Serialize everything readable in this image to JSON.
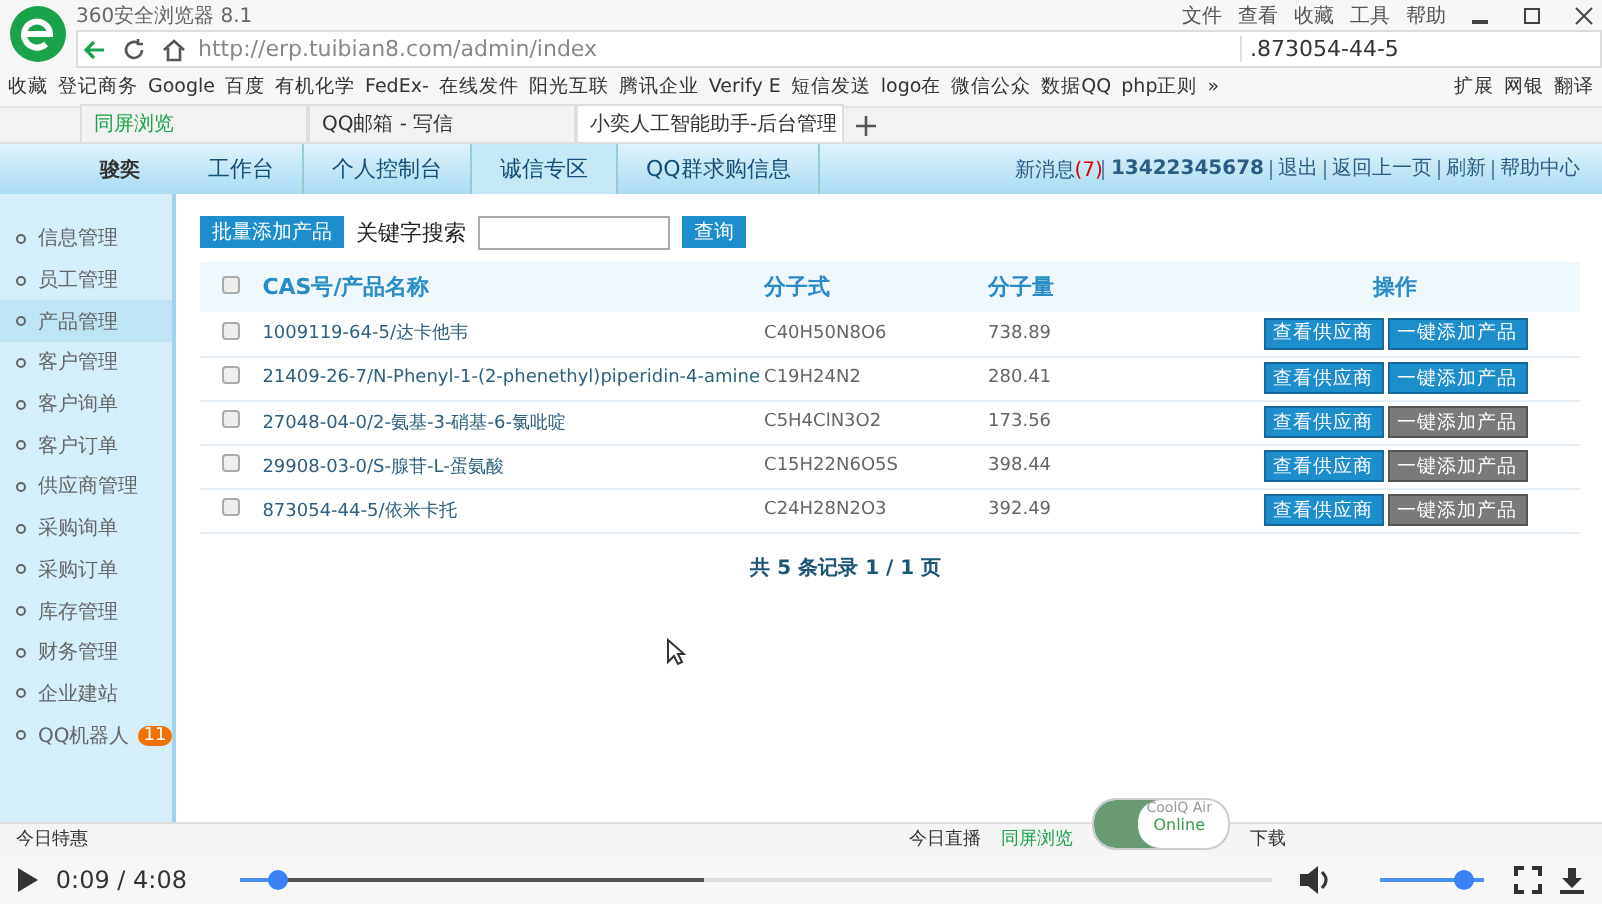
{
  "browser": {
    "title": "360安全浏览器 8.1",
    "menu": [
      "文件",
      "查看",
      "收藏",
      "工具",
      "帮助"
    ],
    "address": "http://erp.tuibian8.com/admin/index",
    "search": ".873054-44-5",
    "bookmarks": [
      "收藏",
      "登记商务",
      "Google",
      "百度",
      "有机化学",
      "FedEx-",
      "在线发件",
      "阳光互联",
      "腾讯企业",
      "Verify E",
      "短信发送",
      "logo在",
      "微信公众",
      "数据QQ",
      "php正则",
      "»"
    ],
    "extras": [
      "扩展",
      "网银",
      "翻译"
    ],
    "tabs": [
      {
        "label": "同屏浏览",
        "selected": false,
        "kind": "special"
      },
      {
        "label": "QQ邮箱 - 写信",
        "selected": false,
        "kind": "page"
      },
      {
        "label": "小奕人工智能助手-后台管理",
        "selected": true,
        "kind": "page"
      }
    ]
  },
  "header": {
    "logo": "骏奕",
    "nav": [
      {
        "label": "工作台",
        "selected": false
      },
      {
        "label": "个人控制台",
        "selected": false
      },
      {
        "label": "诚信专区",
        "selected": true
      },
      {
        "label": "QQ群求购信息",
        "selected": false
      }
    ],
    "messages_label": "新消息",
    "messages_count": "(7)",
    "links": [
      "13422345678",
      "退出",
      "返回上一页",
      "刷新",
      "帮助中心"
    ]
  },
  "sidebar": [
    {
      "label": "信息管理",
      "selected": false
    },
    {
      "label": "员工管理",
      "selected": false
    },
    {
      "label": "产品管理",
      "selected": true
    },
    {
      "label": "客户管理",
      "selected": false
    },
    {
      "label": "客户询单",
      "selected": false
    },
    {
      "label": "客户订单",
      "selected": false
    },
    {
      "label": "供应商管理",
      "selected": false
    },
    {
      "label": "采购询单",
      "selected": false
    },
    {
      "label": "采购订单",
      "selected": false
    },
    {
      "label": "库存管理",
      "selected": false
    },
    {
      "label": "财务管理",
      "selected": false
    },
    {
      "label": "企业建站",
      "selected": false
    },
    {
      "label": "QQ机器人",
      "selected": false,
      "badge": "11"
    }
  ],
  "toolbar": {
    "batch_button": "批量添加产品",
    "search_label": "关键字搜索",
    "query_button": "查询"
  },
  "table": {
    "all_checked": false,
    "columns": [
      "CAS号/产品名称",
      "分子式",
      "分子量",
      "操作"
    ],
    "rows": [
      {
        "name": "1009119-64-5/达卡他韦",
        "formula": "C40H50N8O6",
        "weight": "738.89",
        "actions": [
          "查看供应商",
          "一键添加产品"
        ],
        "checked": false,
        "added": false
      },
      {
        "name": "21409-26-7/N-Phenyl-1-(2-phenethyl)piperidin-4-amine",
        "formula": "C19H24N2",
        "weight": "280.41",
        "actions": [
          "查看供应商",
          "一键添加产品"
        ],
        "checked": false,
        "added": false
      },
      {
        "name": "27048-04-0/2-氨基-3-硝基-6-氯吡啶",
        "formula": "C5H4ClN3O2",
        "weight": "173.56",
        "actions": [
          "查看供应商",
          "一键添加产品"
        ],
        "checked": false,
        "added": true
      },
      {
        "name": "29908-03-0/S-腺苷-L-蛋氨酸",
        "formula": "C15H22N6O5S",
        "weight": "398.44",
        "actions": [
          "查看供应商",
          "一键添加产品"
        ],
        "checked": false,
        "added": true
      },
      {
        "name": "873054-44-5/依米卡托",
        "formula": "C24H28N2O3",
        "weight": "392.49",
        "actions": [
          "查看供应商",
          "一键添加产品"
        ],
        "checked": false,
        "added": true
      }
    ],
    "footer": "共 5 条记录 1 / 1 页"
  },
  "status_bar": {
    "left": "今日特惠",
    "items": [
      "今日直播",
      "同屏浏览",
      "下载"
    ],
    "widget_name": "CoolQ Air",
    "widget_status": "Online"
  },
  "player": {
    "time": "0:09 / 4:08",
    "level": 0.036,
    "volume": {
      "level": 0.95
    }
  }
}
